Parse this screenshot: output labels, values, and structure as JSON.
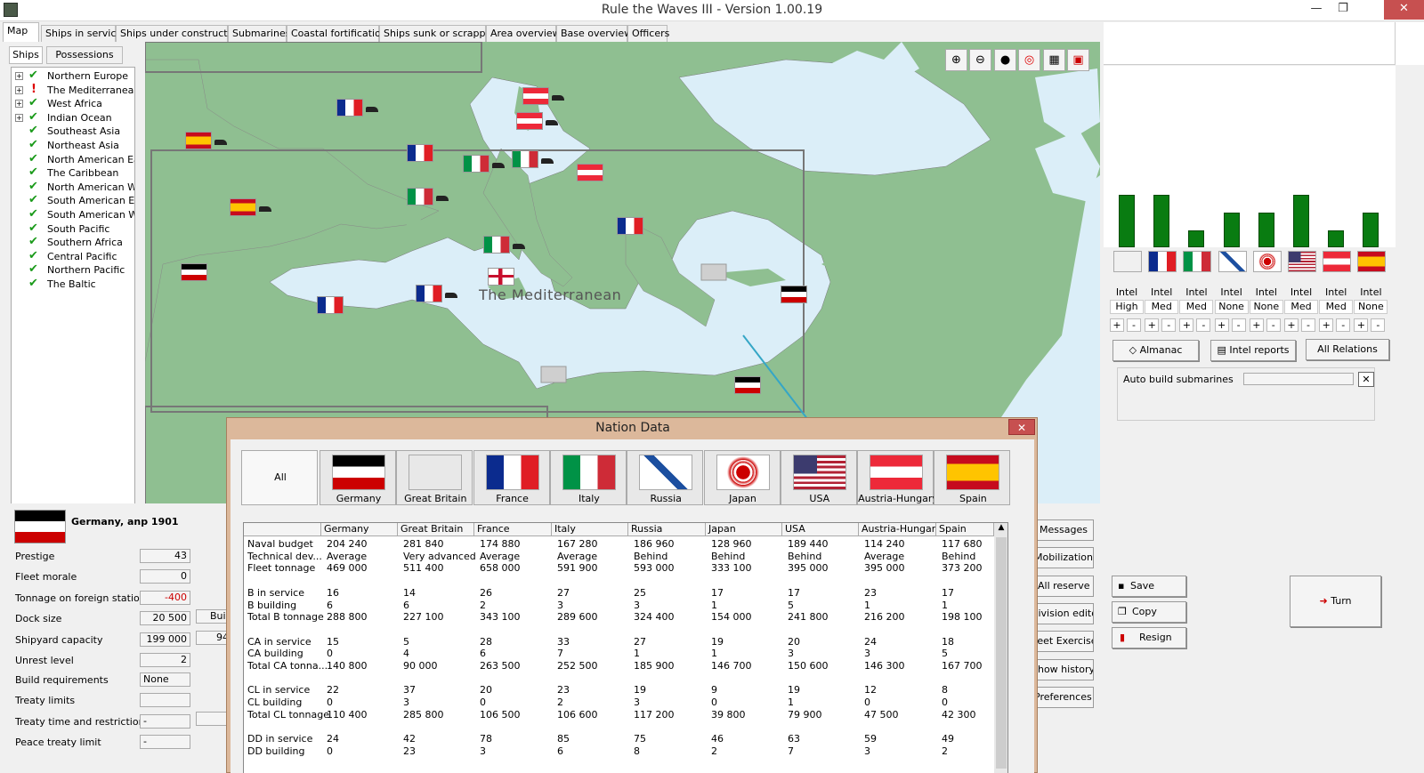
{
  "window": {
    "title": "Rule the Waves III - Version 1.00.19",
    "minimize": "—",
    "restore": "❐",
    "close": "✕"
  },
  "tabs": [
    "Map",
    "Ships in service",
    "Ships under construction",
    "Submarines",
    "Coastal fortifications",
    "Ships sunk or scrapped",
    "Area overview",
    "Base overview",
    "Officers"
  ],
  "subtabs": [
    "Ships",
    "Possessions"
  ],
  "tree": [
    {
      "label": "Northern Europe",
      "exp": "+",
      "mark": "✔"
    },
    {
      "label": "The Mediterranean",
      "exp": "+",
      "mark": "!"
    },
    {
      "label": "West Africa",
      "exp": "+",
      "mark": "✔"
    },
    {
      "label": "Indian Ocean",
      "exp": "+",
      "mark": "✔"
    },
    {
      "label": "Southeast Asia",
      "exp": "",
      "mark": "✔"
    },
    {
      "label": "Northeast Asia",
      "exp": "",
      "mark": "✔"
    },
    {
      "label": "North American East",
      "exp": "",
      "mark": "✔"
    },
    {
      "label": "The Caribbean",
      "exp": "",
      "mark": "✔"
    },
    {
      "label": "North American Wes",
      "exp": "",
      "mark": "✔"
    },
    {
      "label": "South American East",
      "exp": "",
      "mark": "✔"
    },
    {
      "label": "South American Wes",
      "exp": "",
      "mark": "✔"
    },
    {
      "label": "South Pacific",
      "exp": "",
      "mark": "✔"
    },
    {
      "label": "Southern Africa",
      "exp": "",
      "mark": "✔"
    },
    {
      "label": "Central Pacific",
      "exp": "",
      "mark": "✔"
    },
    {
      "label": "Northern Pacific",
      "exp": "",
      "mark": "✔"
    },
    {
      "label": "The Baltic",
      "exp": "",
      "mark": "✔"
    }
  ],
  "map": {
    "label": "The Mediterranean",
    "tools": [
      "zoom-in",
      "zoom-out",
      "oil",
      "target",
      "fleet",
      "grid"
    ]
  },
  "nation_status": {
    "heading": "Germany, anp 1901",
    "rows": [
      {
        "label": "Prestige",
        "value": "43"
      },
      {
        "label": "Fleet morale",
        "value": "0"
      },
      {
        "label": "Tonnage on foreign stations",
        "value": "-400"
      },
      {
        "label": "Dock size",
        "value": "20 500"
      },
      {
        "label": "Shipyard capacity",
        "value": "199 000"
      },
      {
        "label": "Unrest level",
        "value": "2"
      },
      {
        "label": "Build requirements",
        "value": "None"
      },
      {
        "label": "Treaty limits",
        "value": ""
      },
      {
        "label": "Treaty time and restrictions",
        "value": "-"
      },
      {
        "label": "Peace treaty limit",
        "value": "-"
      }
    ],
    "dock_button": "Buil",
    "shipyard_extra": "94"
  },
  "intel": {
    "bars": [
      0.98,
      0.98,
      0.32,
      0.65,
      0.65,
      0.98,
      0.32,
      0.65
    ],
    "labels": [
      "Intel",
      "Intel",
      "Intel",
      "Intel",
      "Intel",
      "Intel",
      "Intel",
      "Intel"
    ],
    "levels": [
      "High",
      "Med",
      "Med",
      "None",
      "None",
      "Med",
      "Med",
      "None"
    ]
  },
  "right_buttons": {
    "almanac": "Almanac",
    "intel_reports": "Intel reports",
    "all_relations": "All Relations",
    "auto_build": "Auto build submarines",
    "save": "Save",
    "copy_game": "Copy game",
    "resign": "Resign",
    "turn": "Turn"
  },
  "side_buttons": [
    "Messages",
    "Mobilization",
    "All reserve",
    "Division editor",
    "Fleet Exercise",
    "Show history",
    "Preferences"
  ],
  "dialog": {
    "title": "Nation Data",
    "close": "✕",
    "all": "All",
    "nations": [
      "Germany",
      "Great Britain",
      "France",
      "Italy",
      "Russia",
      "Japan",
      "USA",
      "Austria-Hungary",
      "Spain"
    ],
    "rows": [
      {
        "label": "Naval budget",
        "values": [
          "204 240",
          "281 840",
          "174 880",
          "167 280",
          "186 960",
          "128 960",
          "189 440",
          "114 240",
          "117 680"
        ]
      },
      {
        "label": "Technical dev...",
        "values": [
          "Average",
          "Very advanced",
          "Average",
          "Average",
          "Behind",
          "Behind",
          "Behind",
          "Average",
          "Behind"
        ]
      },
      {
        "label": "Fleet tonnage",
        "values": [
          "469 000",
          "511 400",
          "658 000",
          "591 900",
          "593 000",
          "333 100",
          "395 000",
          "395 000",
          "373 200"
        ]
      },
      {
        "label": "",
        "values": [
          "",
          "",
          "",
          "",
          "",
          "",
          "",
          "",
          ""
        ]
      },
      {
        "label": "B in service",
        "values": [
          "16",
          "14",
          "26",
          "27",
          "25",
          "17",
          "17",
          "23",
          "17"
        ]
      },
      {
        "label": "B building",
        "values": [
          "6",
          "6",
          "2",
          "3",
          "3",
          "1",
          "5",
          "1",
          "1"
        ]
      },
      {
        "label": "Total B tonnage",
        "values": [
          "288 800",
          "227 100",
          "343 100",
          "289 600",
          "324 400",
          "154 000",
          "241 800",
          "216 200",
          "198 100"
        ]
      },
      {
        "label": "",
        "values": [
          "",
          "",
          "",
          "",
          "",
          "",
          "",
          "",
          ""
        ]
      },
      {
        "label": "CA in service",
        "values": [
          "15",
          "5",
          "28",
          "33",
          "27",
          "19",
          "20",
          "24",
          "18"
        ]
      },
      {
        "label": "CA building",
        "values": [
          "0",
          "4",
          "6",
          "7",
          "1",
          "1",
          "3",
          "3",
          "5"
        ]
      },
      {
        "label": "Total CA tonna...",
        "values": [
          "140 800",
          "90 000",
          "263 500",
          "252 500",
          "185 900",
          "146 700",
          "150 600",
          "146 300",
          "167 700"
        ]
      },
      {
        "label": "",
        "values": [
          "",
          "",
          "",
          "",
          "",
          "",
          "",
          "",
          ""
        ]
      },
      {
        "label": "CL in service",
        "values": [
          "22",
          "37",
          "20",
          "23",
          "19",
          "9",
          "19",
          "12",
          "8"
        ]
      },
      {
        "label": "CL building",
        "values": [
          "0",
          "3",
          "0",
          "2",
          "3",
          "0",
          "1",
          "0",
          "0"
        ]
      },
      {
        "label": "Total CL tonnage",
        "values": [
          "110 400",
          "285 800",
          "106 500",
          "106 600",
          "117 200",
          "39 800",
          "79 900",
          "47 500",
          "42 300"
        ]
      },
      {
        "label": "",
        "values": [
          "",
          "",
          "",
          "",
          "",
          "",
          "",
          "",
          ""
        ]
      },
      {
        "label": "DD in service",
        "values": [
          "24",
          "42",
          "78",
          "85",
          "75",
          "46",
          "63",
          "59",
          "49"
        ]
      },
      {
        "label": "DD building",
        "values": [
          "0",
          "23",
          "3",
          "6",
          "8",
          "2",
          "7",
          "3",
          "2"
        ]
      }
    ]
  },
  "colors": {
    "map_land": "#8fbf91",
    "map_sea": "#dbeef8",
    "bar": "#097c11",
    "dialog_frame": "#dcb89b",
    "close_red": "#c75050"
  }
}
